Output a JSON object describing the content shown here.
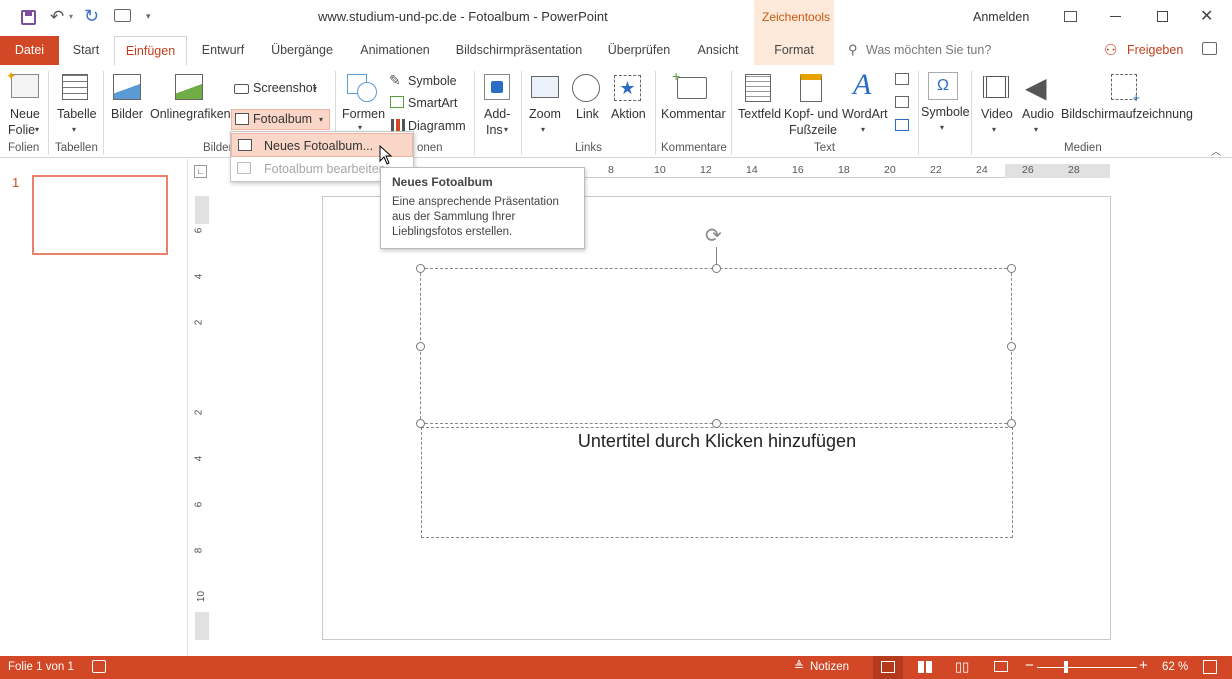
{
  "title": {
    "text": "www.studium-und-pc.de - Fotoalbum  -  PowerPoint",
    "context_label": "Zeichentools",
    "signin": "Anmelden"
  },
  "tabs": {
    "file": "Datei",
    "start": "Start",
    "insert": "Einfügen",
    "design": "Entwurf",
    "transitions": "Übergänge",
    "animations": "Animationen",
    "slideshow": "Bildschirmpräsentation",
    "review": "Überprüfen",
    "view": "Ansicht",
    "format": "Format",
    "tellme": "Was möchten Sie tun?",
    "share": "Freigeben"
  },
  "ribbon": {
    "new_slide_1": "Neue",
    "new_slide_2": "Folie",
    "table": "Tabelle",
    "pictures": "Bilder",
    "online_pictures": "Onlinegrafiken",
    "screenshot": "Screenshot",
    "photo_album": "Fotoalbum",
    "shapes": "Formen",
    "icons": "Symbole",
    "smartart": "SmartArt",
    "chart": "Diagramm",
    "addins_1": "Add-",
    "addins_2": "Ins",
    "zoom": "Zoom",
    "link": "Link",
    "action": "Aktion",
    "comment": "Kommentar",
    "textbox": "Textfeld",
    "header_footer_1": "Kopf- und",
    "header_footer_2": "Fußzeile",
    "wordart": "WordArt",
    "symbols": "Symbole",
    "video": "Video",
    "audio": "Audio",
    "screen_recording": "Bildschirmaufzeichnung",
    "groups": {
      "slides": "Folien",
      "tables": "Tabellen",
      "images": "Bilder",
      "illustrations": "onen",
      "links": "Links",
      "comments": "Kommentare",
      "text": "Text",
      "media": "Medien"
    }
  },
  "dropdown": {
    "new_album": "Neues Fotoalbum...",
    "edit_album": "Fotoalbum bearbeiten..."
  },
  "tooltip": {
    "title": "Neues Fotoalbum",
    "body": "Eine ansprechende Präsentation aus der Sammlung Ihrer Lieblingsfotos erstellen."
  },
  "ruler": {
    "h_ticks": [
      "8",
      "10",
      "12",
      "14",
      "16",
      "18",
      "20",
      "22",
      "24",
      "26",
      "28"
    ],
    "v_ticks": [
      "6",
      "4",
      "2",
      "2",
      "4",
      "6",
      "8",
      "10"
    ]
  },
  "thumbnail": {
    "number": "1"
  },
  "slide": {
    "subtitle_placeholder": "Untertitel durch Klicken hinzufügen"
  },
  "status": {
    "slide_count": "Folie 1 von 1",
    "notes": "Notizen",
    "zoom": "62 %"
  },
  "colors": {
    "accent": "#d24726",
    "context_tab": "#fde9d9",
    "highlight": "#fad6c9"
  }
}
